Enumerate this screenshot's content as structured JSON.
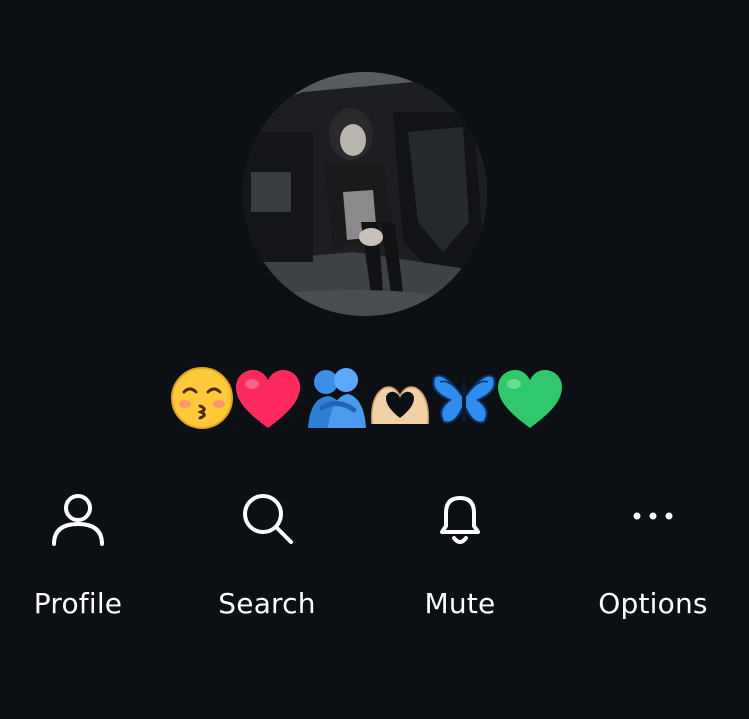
{
  "profile": {
    "status_emojis": [
      "kissing-face-smiling-eyes",
      "red-heart",
      "people-hugging",
      "heart-hands",
      "butterfly",
      "green-heart"
    ]
  },
  "actions": [
    {
      "label": "Profile",
      "icon": "person-icon"
    },
    {
      "label": "Search",
      "icon": "search-icon"
    },
    {
      "label": "Mute",
      "icon": "bell-icon"
    },
    {
      "label": "Options",
      "icon": "more-dots-icon"
    }
  ],
  "colors": {
    "background": "#0c0f14",
    "text": "#ffffff"
  }
}
